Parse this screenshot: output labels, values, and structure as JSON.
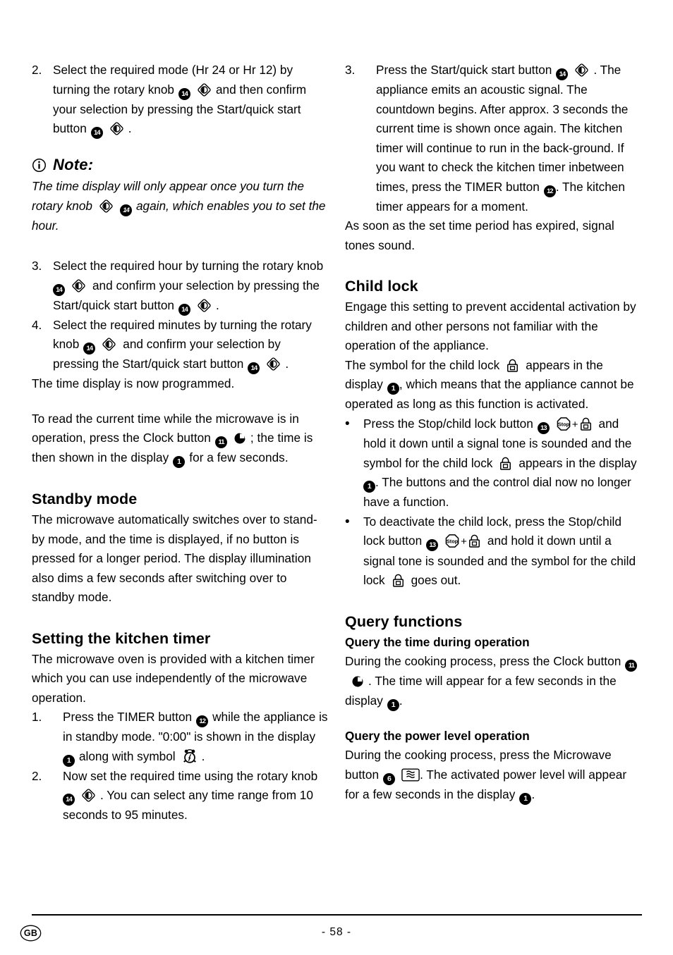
{
  "document": {
    "language_badge": "GB",
    "page_number": "- 58 -"
  },
  "icons": {
    "rotary_knob": "rotary-knob-icon",
    "clock": "clock-icon",
    "child_lock": "padlock-icon",
    "stop": "stop-octagon-icon",
    "kitchen_timer": "alarm-clock-icon",
    "microwave": "microwave-waves-icon",
    "info": "info-circle-icon"
  },
  "badges": {
    "display": "1",
    "microwave_button": "6",
    "clock_button": "11",
    "timer_button": "12",
    "stop_child_lock_button": "13",
    "rotary_knob_button": "14"
  },
  "left_column": {
    "step2": {
      "marker": "2.",
      "text_a": "Select the required mode (Hr 24 or Hr 12) by turning the rotary knob",
      "text_b": "and then confirm your selection by pressing the Start/quick start button",
      "text_c": "."
    },
    "note": {
      "title": "Note:",
      "body_a": "The time display will only appear once you turn the rotary knob",
      "body_b": "again, which enables you to set the hour."
    },
    "step3": {
      "marker": "3.",
      "text_a": "Select the required hour by turning the rotary knob",
      "text_b": "and confirm your selection by pressing the Start/quick start button",
      "text_c": "."
    },
    "step4": {
      "marker": "4.",
      "text_a": "Select the required minutes by turning the rotary knob",
      "text_b": "and confirm your selection by pressing the Start/quick start button",
      "text_c": "."
    },
    "programmed_line": "The time display is now programmed.",
    "read_time": {
      "text_a": "To read the current time while the microwave is in operation, press the Clock button",
      "text_b": "; the time is then shown in the display",
      "text_c": "for a few seconds."
    },
    "standby": {
      "heading": "Standby mode",
      "body": "The microwave automatically switches over to stand-by mode, and the time is displayed, if no button is pressed for a longer period. The display illumination also dims a few seconds after switching over to standby mode."
    },
    "kitchen_timer": {
      "heading": "Setting the kitchen timer",
      "intro": "The microwave oven is provided with a kitchen timer which you can use independently of the microwave operation.",
      "step1": {
        "marker": "1.",
        "text_a": "Press the TIMER button",
        "text_b": "while the appliance is in standby mode. \"0:00\" is shown in the display",
        "text_c": "along with symbol",
        "text_d": "."
      },
      "step2": {
        "marker": "2.",
        "text_a": "Now set the required time using the rotary knob",
        "text_b": ". You can select any time range from 10 seconds to 95 minutes."
      }
    }
  },
  "right_column": {
    "step3": {
      "marker": "3.",
      "text_a": "Press the Start/quick start button",
      "text_b": ". The appliance emits an acoustic signal. The countdown begins. After approx. 3 seconds the current time is shown once again. The kitchen timer will continue to run in the back-ground. If you want to check the kitchen timer inbetween times, press the TIMER button",
      "text_c": ". The kitchen timer appears for a moment."
    },
    "expired_line": "As soon as the set time period has expired, signal tones sound.",
    "child_lock": {
      "heading": "Child lock",
      "intro": "Engage this setting to prevent accidental activation by children and other persons not familiar with the operation of the appliance.",
      "symbol_para": {
        "text_a": "The symbol for the child lock",
        "text_b": "appears in the display",
        "text_c": ", which means that the appliance cannot be operated as long as this function is activated."
      },
      "bullet1": {
        "marker": "•",
        "text_a": "Press the Stop/child lock button",
        "text_b": "and hold it down until a signal tone is sounded and the symbol for the child lock",
        "text_c": "appears in the display",
        "text_d": ". The buttons and the control dial now no longer have a function."
      },
      "bullet2": {
        "marker": "•",
        "text_a": "To deactivate the child lock, press the Stop/child lock button",
        "text_b": "and hold it down until a signal tone is sounded and the symbol for the child lock",
        "text_c": "goes out."
      }
    },
    "query_functions": {
      "heading": "Query functions",
      "time_query": {
        "subheading": "Query the time during operation",
        "text_a": "During the cooking process, press the Clock button",
        "text_b": ". The time will appear for a few seconds in the display",
        "text_c": "."
      },
      "power_query": {
        "subheading": "Query the power level operation",
        "text_a": "During the cooking process, press the Microwave button",
        "text_b": ". The activated power level will appear for a few seconds in the display",
        "text_c": "."
      }
    }
  }
}
